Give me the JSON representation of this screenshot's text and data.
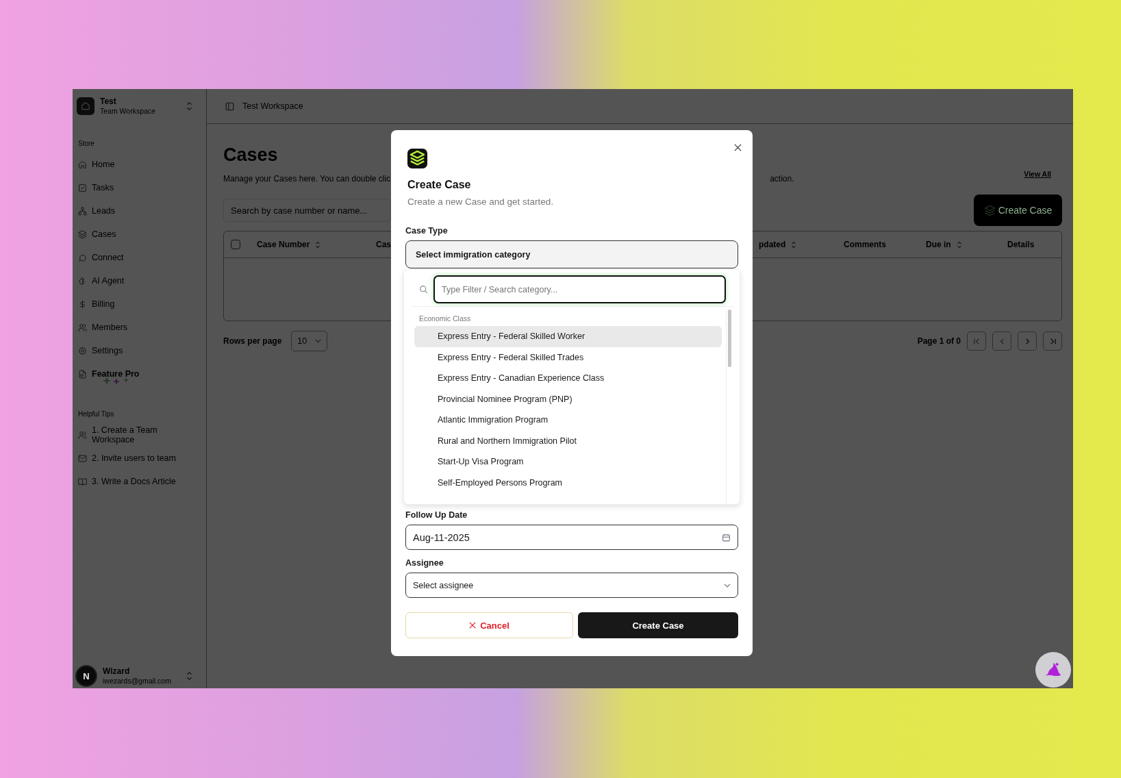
{
  "workspace": {
    "name": "Test",
    "subtitle": "Team Workspace"
  },
  "sidebar": {
    "sections": [
      {
        "title": "Store",
        "items": [
          {
            "label": "Home",
            "emphasized": false
          },
          {
            "label": "Tasks",
            "emphasized": false
          },
          {
            "label": "Leads",
            "emphasized": false
          },
          {
            "label": "Cases",
            "emphasized": false
          },
          {
            "label": "Connect",
            "emphasized": false
          },
          {
            "label": "AI Agent",
            "emphasized": false
          },
          {
            "label": "Billing",
            "emphasized": false
          },
          {
            "label": "Members",
            "emphasized": false
          },
          {
            "label": "Settings",
            "emphasized": false
          },
          {
            "label": "Feature Pro",
            "emphasized": true
          }
        ]
      },
      {
        "title": "Helpful Tips",
        "items": [
          {
            "label": "1. Create a Team Workspace",
            "emphasized": false
          },
          {
            "label": "2. Invite users to team",
            "emphasized": false
          },
          {
            "label": "3. Write a Docs Article",
            "emphasized": false
          }
        ]
      }
    ]
  },
  "user": {
    "initial": "N",
    "name": "Wizard",
    "email": "iwezards@gmail.com"
  },
  "header": {
    "title": "Test Workspace"
  },
  "page": {
    "title": "Cases",
    "description_visible_left": "Manage your Cases here. You can double clic",
    "description_visible_right": "action.",
    "view_all": "View All",
    "search_placeholder": "Search by case number or name...",
    "create_button": "Create Case"
  },
  "table": {
    "select_all_checked": false,
    "columns": [
      {
        "label": "Case Number",
        "sortable": true
      },
      {
        "label": "Cas",
        "sortable": false
      },
      {
        "label": "pdated",
        "sortable": true
      },
      {
        "label": "Comments",
        "sortable": false
      },
      {
        "label": "Due in",
        "sortable": true
      },
      {
        "label": "Details",
        "sortable": false
      }
    ]
  },
  "pagination": {
    "rows_label": "Rows per page",
    "rows_value": "10",
    "page_label": "Page 1 of 0"
  },
  "dialog": {
    "title": "Create Case",
    "subtitle": "Create a new Case and get started.",
    "case_type": {
      "label": "Case Type",
      "placeholder": "Select immigration category",
      "search_placeholder": "Type Filter / Search category...",
      "group": "Economic Class",
      "options": [
        {
          "label": "Express Entry - Federal Skilled Worker",
          "highlighted": true
        },
        {
          "label": "Express Entry - Federal Skilled Trades",
          "highlighted": false
        },
        {
          "label": "Express Entry - Canadian Experience Class",
          "highlighted": false
        },
        {
          "label": "Provincial Nominee Program (PNP)",
          "highlighted": false
        },
        {
          "label": "Atlantic Immigration Program",
          "highlighted": false
        },
        {
          "label": "Rural and Northern Immigration Pilot",
          "highlighted": false
        },
        {
          "label": "Start-Up Visa Program",
          "highlighted": false
        },
        {
          "label": "Self-Employed Persons Program",
          "highlighted": false
        }
      ]
    },
    "follow_up": {
      "label": "Follow Up Date",
      "value": "Aug-11-2025"
    },
    "assignee": {
      "label": "Assignee",
      "placeholder": "Select assignee"
    },
    "cancel": "Cancel",
    "submit": "Create Case"
  }
}
